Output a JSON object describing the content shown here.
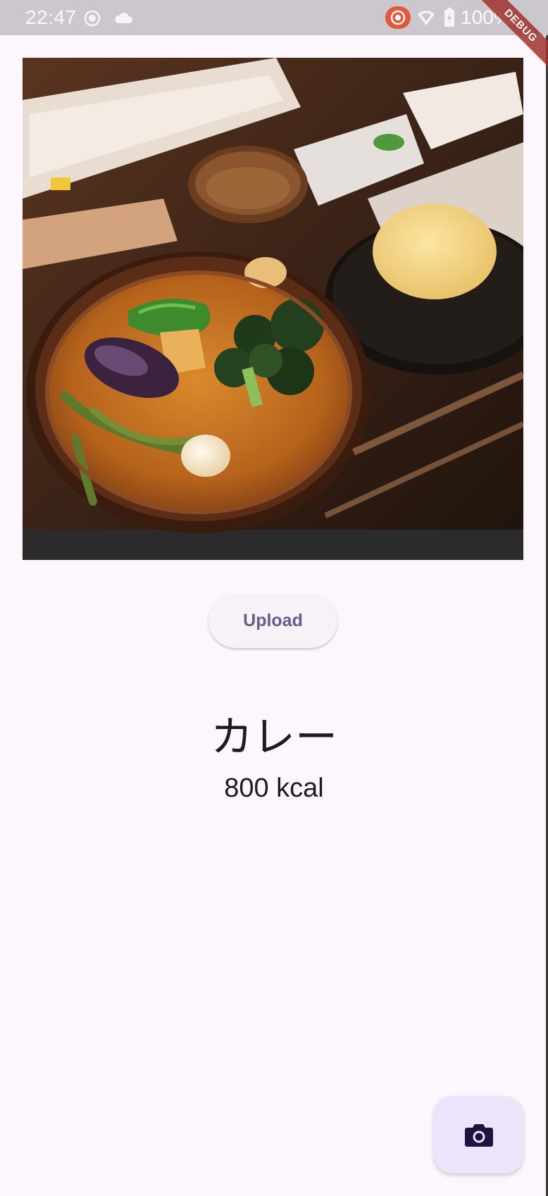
{
  "status_bar": {
    "time": "22:47",
    "battery_text": "100%",
    "icons": [
      "record-icon",
      "cloud-icon",
      "cast-icon",
      "wifi-icon",
      "battery-icon"
    ]
  },
  "debug_banner": {
    "label": "DEBUG"
  },
  "photo": {
    "subject": "soup curry meal with rice"
  },
  "upload_button": {
    "label": "Upload"
  },
  "result": {
    "dish_name": "カレー",
    "calories": "800 kcal"
  },
  "fab": {
    "icon": "camera-icon"
  },
  "colors": {
    "background": "#fdf7fd",
    "status_bar": "#ccc7cc",
    "primary_text": "#1e1b20",
    "button_text": "#6b5b8d",
    "fab_background": "#ece4fb",
    "fab_icon": "#1d1442",
    "debug_ribbon": "#a0322f"
  }
}
